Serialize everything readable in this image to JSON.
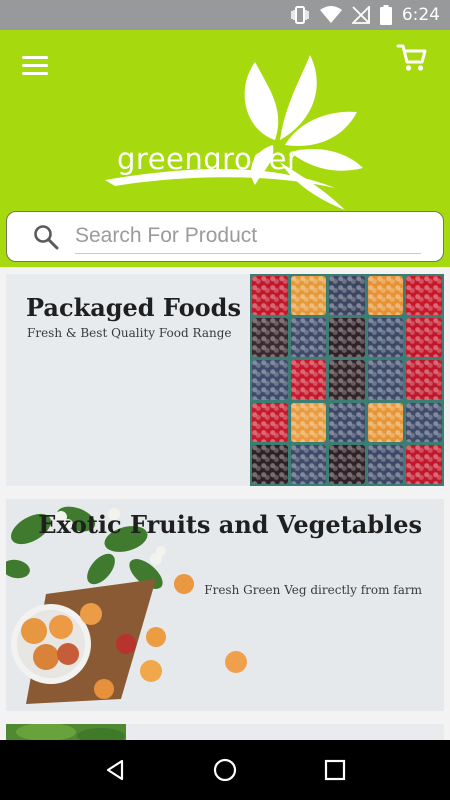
{
  "status_bar": {
    "time": "6:24"
  },
  "header": {
    "logo_text": "greengrocer"
  },
  "search": {
    "placeholder": "Search For Product"
  },
  "banners": [
    {
      "title": "Packaged Foods",
      "subtitle": "Fresh & Best Quality Food Range"
    },
    {
      "title": "Exotic Fruits and Vegetables",
      "subtitle": "Fresh Green Veg directly from farm"
    }
  ],
  "colors": {
    "header": "#a6d90e",
    "status_bar": "#98999a",
    "nav_bar": "#000000"
  },
  "icons": [
    "vibrate-icon",
    "wifi-icon",
    "no-signal-icon",
    "battery-icon",
    "menu-icon",
    "cart-icon",
    "search-icon",
    "back-icon",
    "home-icon",
    "recents-icon"
  ]
}
